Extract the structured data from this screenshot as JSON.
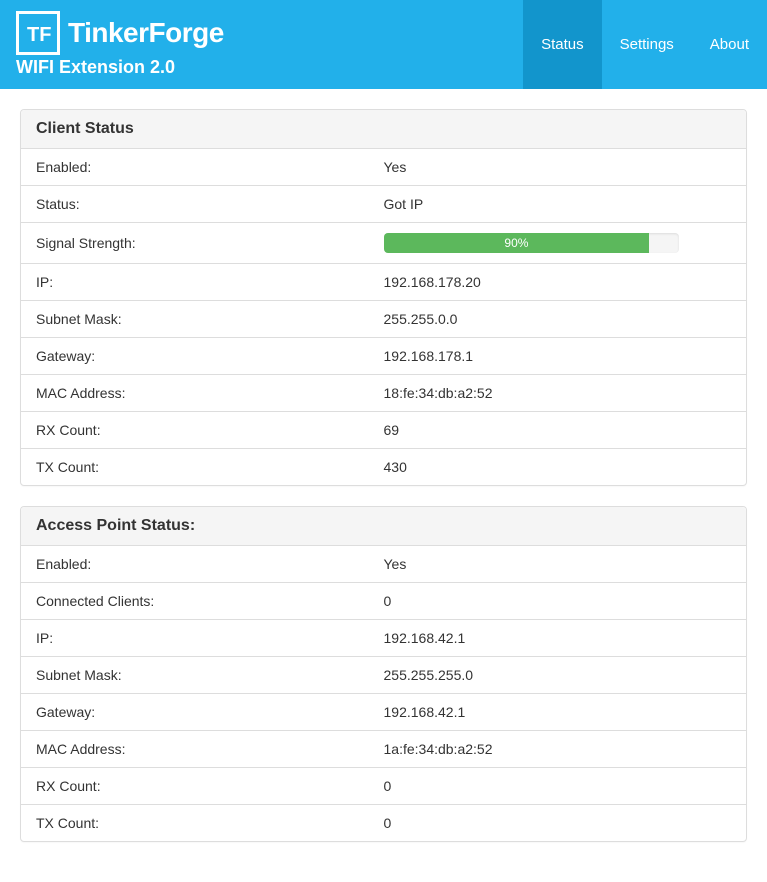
{
  "header": {
    "brand_name": "TinkerForge",
    "brand_sub": "WIFI Extension 2.0"
  },
  "nav": {
    "status": "Status",
    "settings": "Settings",
    "about": "About"
  },
  "client": {
    "title": "Client Status",
    "enabled_label": "Enabled:",
    "enabled": "Yes",
    "status_label": "Status:",
    "status": "Got IP",
    "signal_label": "Signal Strength:",
    "signal_pct": "90%",
    "ip_label": "IP:",
    "ip": "192.168.178.20",
    "subnet_label": "Subnet Mask:",
    "subnet": "255.255.0.0",
    "gateway_label": "Gateway:",
    "gateway": "192.168.178.1",
    "mac_label": "MAC Address:",
    "mac": "18:fe:34:db:a2:52",
    "rx_label": "RX Count:",
    "rx": "69",
    "tx_label": "TX Count:",
    "tx": "430"
  },
  "ap": {
    "title": "Access Point Status:",
    "enabled_label": "Enabled:",
    "enabled": "Yes",
    "clients_label": "Connected Clients:",
    "clients": "0",
    "ip_label": "IP:",
    "ip": "192.168.42.1",
    "subnet_label": "Subnet Mask:",
    "subnet": "255.255.255.0",
    "gateway_label": "Gateway:",
    "gateway": "192.168.42.1",
    "mac_label": "MAC Address:",
    "mac": "1a:fe:34:db:a2:52",
    "rx_label": "RX Count:",
    "rx": "0",
    "tx_label": "TX Count:",
    "tx": "0"
  }
}
